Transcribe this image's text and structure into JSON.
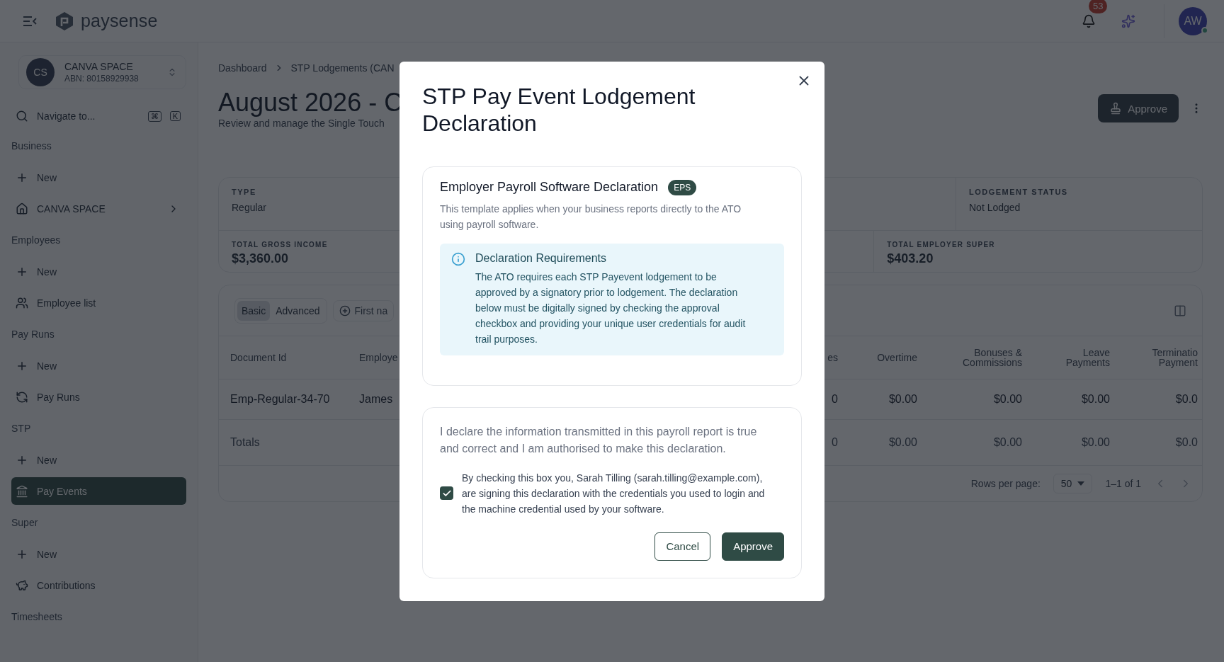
{
  "header": {
    "brand": "paysense",
    "notification_count": "53",
    "avatar": "AW"
  },
  "sidebar": {
    "org": {
      "initials": "CS",
      "name": "CANVA SPACE",
      "abn": "ABN: 80158929938"
    },
    "search": {
      "placeholder": "Navigate to...",
      "keys": [
        "⌘",
        "K"
      ]
    },
    "sections": [
      {
        "title": "Business",
        "items": [
          {
            "label": "New",
            "selected": false
          },
          {
            "label": "CANVA SPACE",
            "selected": false,
            "expandable": true
          }
        ]
      },
      {
        "title": "Employees",
        "items": [
          {
            "label": "New",
            "selected": false
          },
          {
            "label": "Employee list",
            "selected": false
          }
        ]
      },
      {
        "title": "Pay Runs",
        "items": [
          {
            "label": "New",
            "selected": false
          },
          {
            "label": "Pay Runs",
            "selected": false
          }
        ]
      },
      {
        "title": "STP",
        "items": [
          {
            "label": "New",
            "selected": false
          },
          {
            "label": "Pay Events",
            "selected": true
          }
        ]
      },
      {
        "title": "Super",
        "items": [
          {
            "label": "New",
            "selected": false
          },
          {
            "label": "Contributions",
            "selected": false
          }
        ]
      },
      {
        "title": "Timesheets"
      }
    ]
  },
  "breadcrumb": [
    "Dashboard",
    "STP Lodgements (CAN"
  ],
  "page": {
    "title": "August 2026 - C",
    "subtitle": "Review and manage the Single Touch",
    "approve": "Approve"
  },
  "details": [
    {
      "label": "TYPE",
      "value": "Regular"
    },
    {
      "label": "LODGEMENT STATUS",
      "value": "Not Lodged"
    }
  ],
  "totals": [
    {
      "label": "TOTAL GROSS INCOME",
      "value": "$3,360.00"
    },
    {
      "label": "TOTAL EMPLOYER SUPER",
      "value": "$403.20"
    }
  ],
  "table": {
    "view_tabs": [
      {
        "label": "Basic",
        "selected": true
      },
      {
        "label": "Advanced",
        "selected": false
      }
    ],
    "filter": "First na",
    "columns": [
      "Document Id",
      "Employe",
      "es",
      "Overtime",
      "Bonuses & Commissions",
      "Leave Payments",
      "Terminatio Payment"
    ],
    "rows": [
      {
        "document_id": "Emp-Regular-34-70",
        "employee": "James",
        "values": [
          "0",
          "$0.00",
          "$0.00",
          "$0.00",
          "$0.0"
        ]
      }
    ],
    "totals_row": {
      "label": "Totals",
      "values": [
        "0",
        "$0.00",
        "$0.00",
        "$0.00",
        "$0.0"
      ]
    },
    "pagination": {
      "rows_per_page_label": "Rows per page:",
      "rows_per_page": "50",
      "range": "1–1 of 1"
    }
  },
  "modal": {
    "title": "STP Pay Event Lodgement Declaration",
    "template": {
      "title": "Employer Payroll Software Declaration",
      "badge": "EPS",
      "description": "This template applies when your business reports directly to the ATO using payroll software."
    },
    "info": {
      "title": "Declaration Requirements",
      "text": "The ATO requires each STP Payevent lodgement to be approved by a signatory prior to lodgement. The declaration below must be digitally signed by checking the approval checkbox and providing your unique user credentials for audit trail purposes."
    },
    "declaration": "I declare the information transmitted in this payroll report is true and correct and I am authorised to make this declaration.",
    "consent": {
      "text": "By checking this box you, Sarah Tilling (sarah.tilling@example.com), are signing this declaration with the credentials you used to login and the machine credential used by your software.",
      "checked": true
    },
    "buttons": [
      {
        "label": "Cancel",
        "kind": "secondary"
      },
      {
        "label": "Approve",
        "kind": "primary"
      }
    ]
  }
}
